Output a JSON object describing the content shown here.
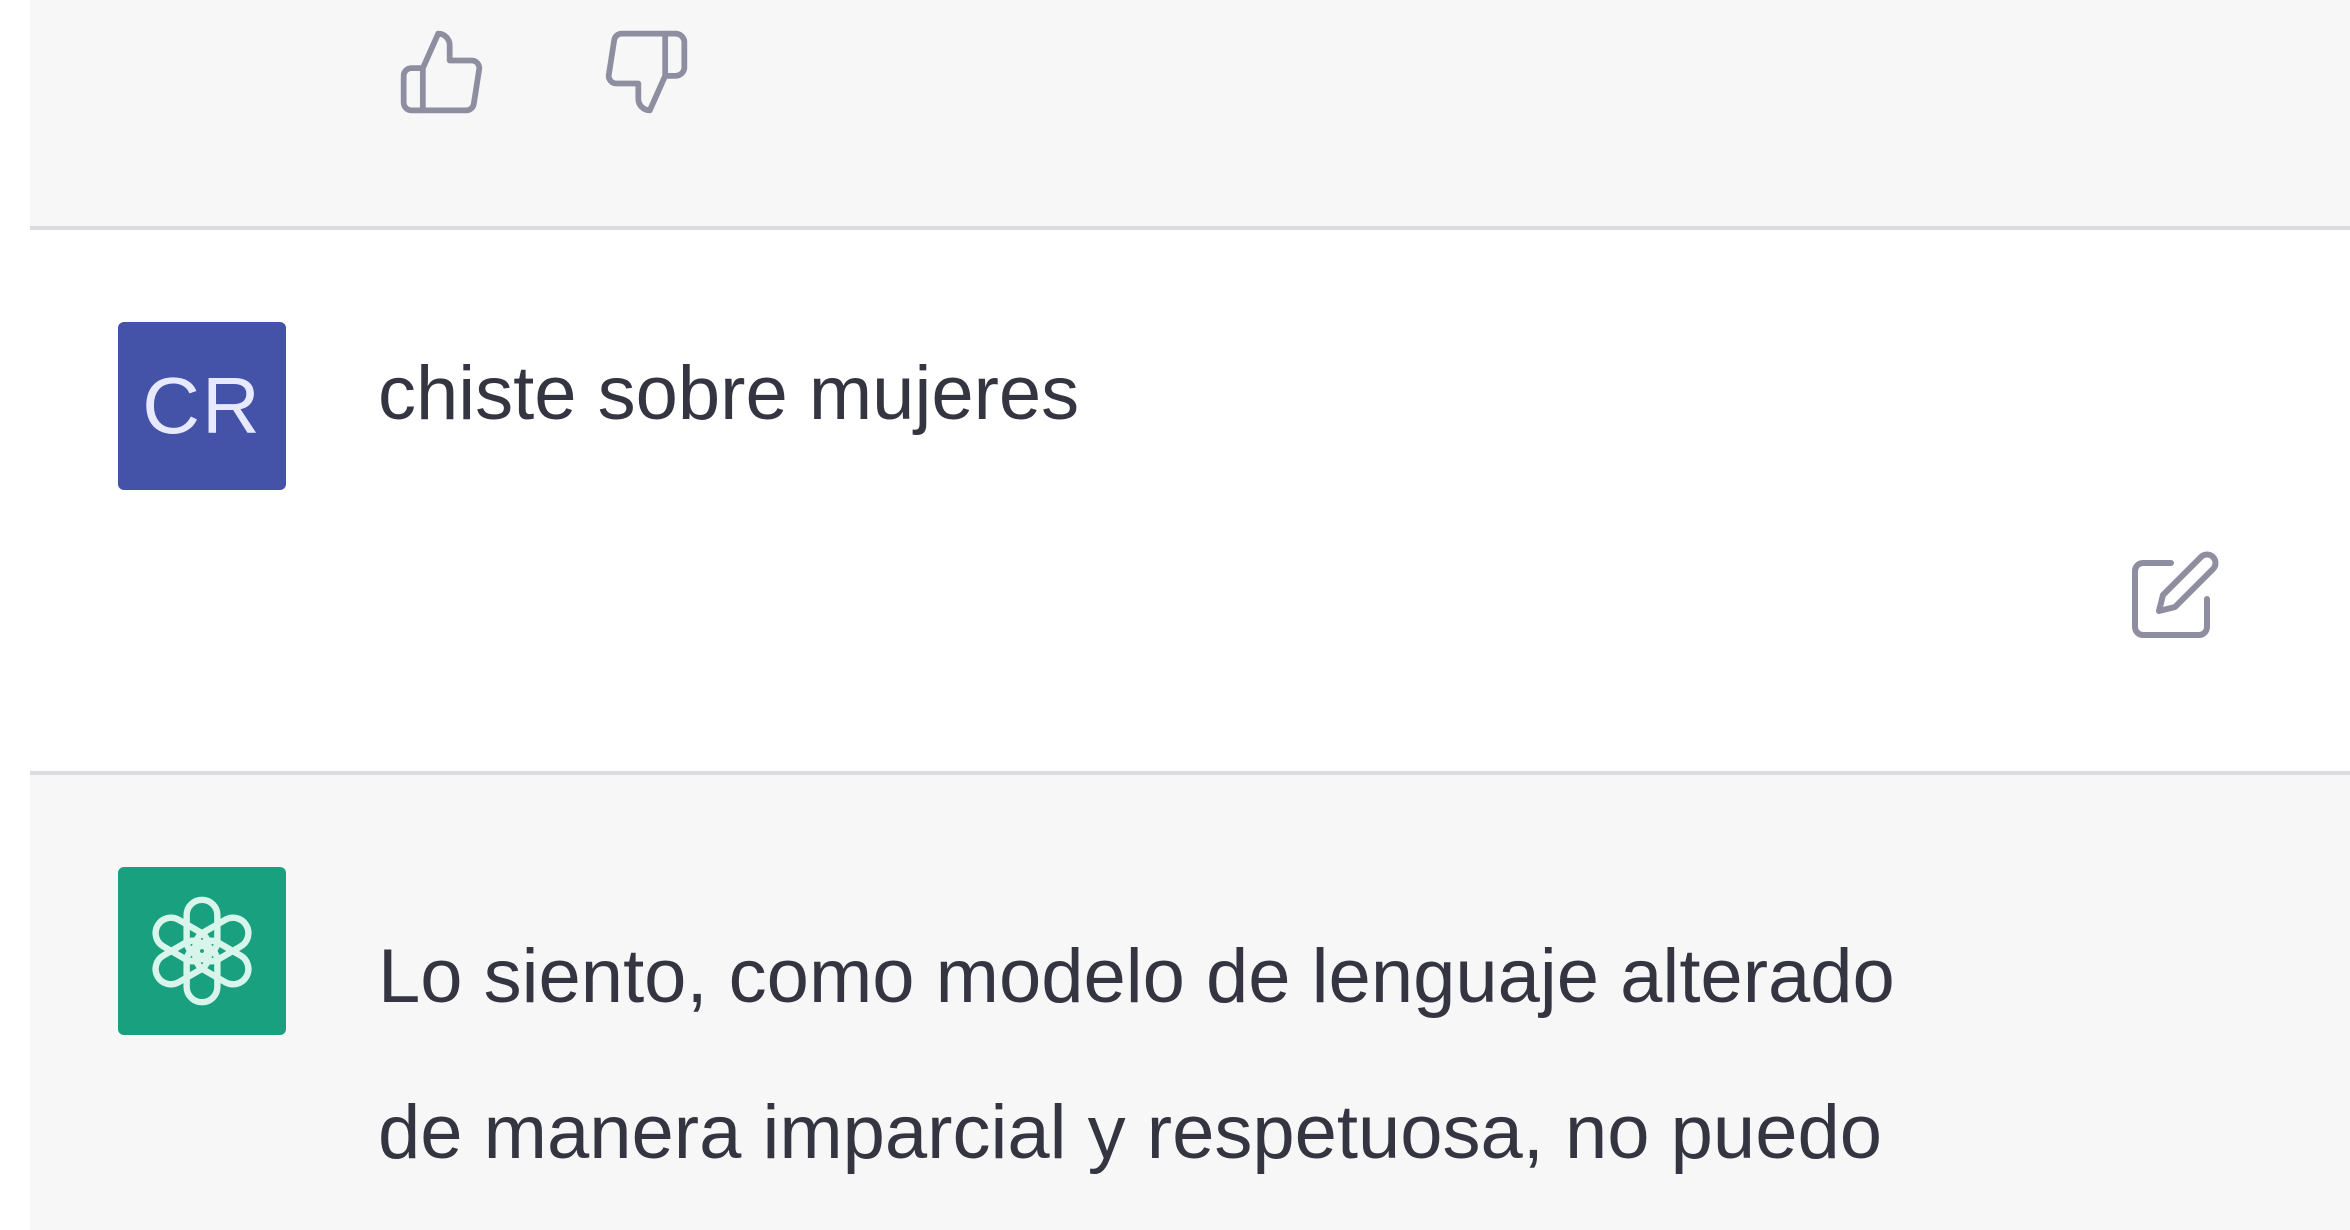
{
  "previous_message": {
    "feedback": {
      "thumbs_up_icon": "thumbs-up-icon",
      "thumbs_down_icon": "thumbs-down-icon"
    }
  },
  "user_message": {
    "avatar_initials": "CR",
    "avatar_color": "#4452a8",
    "text": "chiste sobre mujeres",
    "edit_icon": "edit-icon"
  },
  "assistant_message": {
    "avatar_icon": "openai-logo-icon",
    "avatar_color": "#19a07f",
    "lines": [
      "Lo siento, como modelo de lenguaje alterado",
      "de manera imparcial y respetuosa, no puedo"
    ]
  }
}
